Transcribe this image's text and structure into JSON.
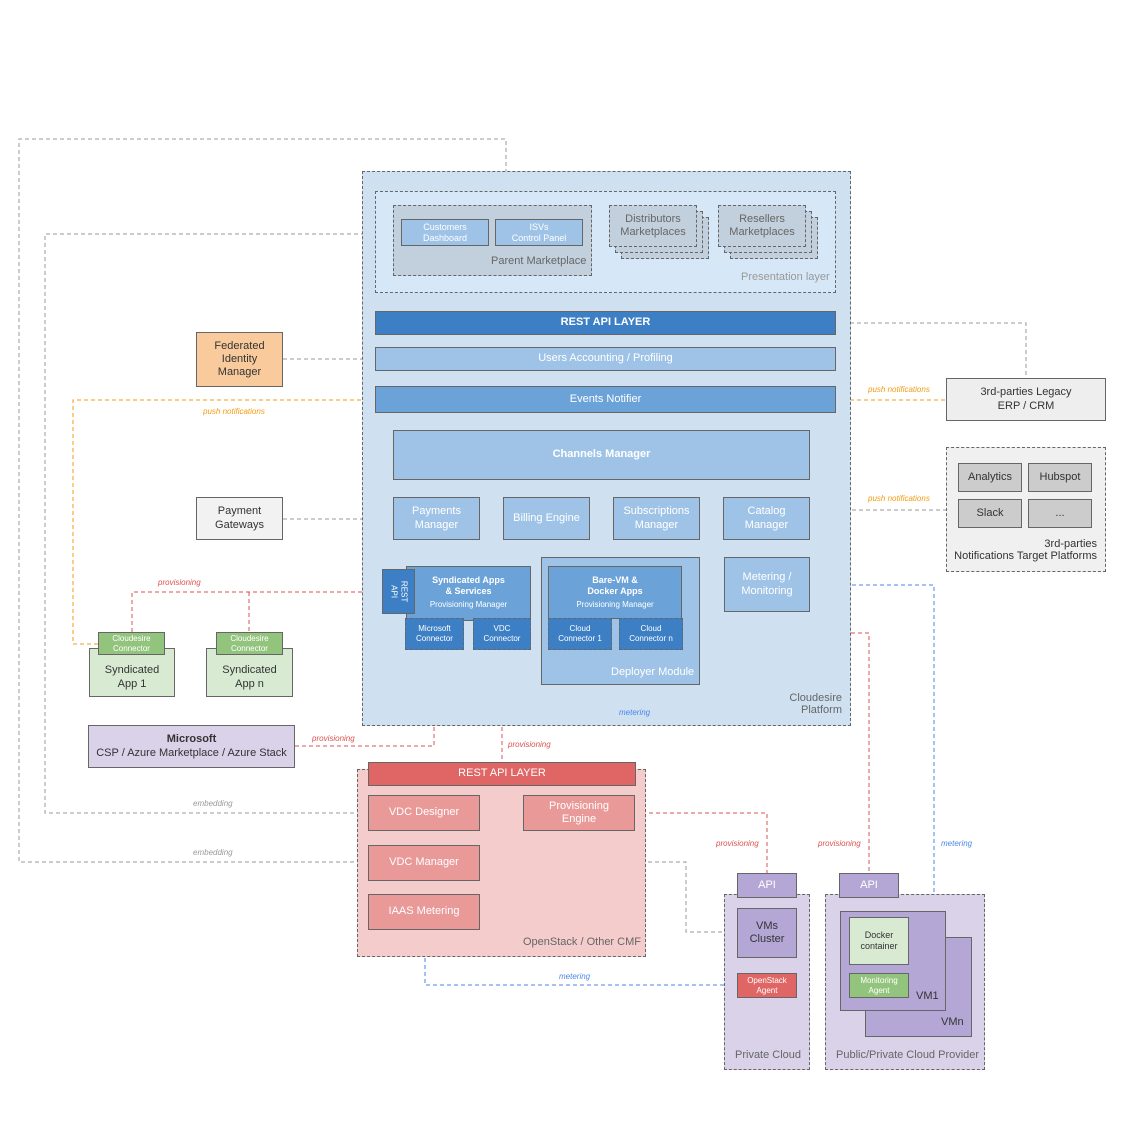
{
  "colors": {
    "platform": "#cfe0f1",
    "rest": "#3d7fc4",
    "light_blue": "#9fc3e7",
    "mid_blue": "#6ba3d9",
    "orange": "#f39c12",
    "red": "#d9534f",
    "blue_line": "#4a86e8",
    "gray_line": "#999999",
    "openstack": "#f4cccc",
    "purple": "#d9d2e9",
    "green": "#93c47d"
  },
  "platform": {
    "label": "Cloudesire\nPlatform",
    "presentation_label": "Presentation layer",
    "parent_marketplace": "Parent Marketplace",
    "customers_dashboard": "Customers\nDashboard",
    "isvs_panel": "ISVs\nControl Panel",
    "distributors": "Distributors\nMarketplaces",
    "resellers": "Resellers\nMarketplaces",
    "rest_api": "REST API LAYER",
    "users_accounting": "Users Accounting / Profiling",
    "events_notifier": "Events Notifier",
    "channels_manager": "Channels Manager",
    "payments_manager": "Payments\nManager",
    "billing_engine": "Billing Engine",
    "subscriptions_manager": "Subscriptions\nManager",
    "catalog_manager": "Catalog\nManager",
    "syndicated_title": "Syndicated Apps\n& Services",
    "syndicated_sub": "Provisioning Manager",
    "rest_api_small": "REST\nAPI",
    "microsoft_connector": "Microsoft\nConnector",
    "vdc_connector": "VDC\nConnector",
    "deployer_module": "Deployer Module",
    "baremetal_title": "Bare-VM &\nDocker Apps",
    "baremetal_sub": "Provisioning Manager",
    "cloud_connector_1": "Cloud\nConnector 1",
    "cloud_connector_n": "Cloud\nConnector n",
    "metering": "Metering /\nMonitoring"
  },
  "external": {
    "federated_identity": "Federated\nIdentity\nManager",
    "payment_gateways": "Payment\nGateways",
    "legacy_erp": "3rd-parties Legacy\nERP / CRM",
    "notifications_label": "3rd-parties\nNotifications Target Platforms",
    "analytics": "Analytics",
    "hubspot": "Hubspot",
    "slack": "Slack",
    "more": "...",
    "cloudesire_connector": "Cloudesire\nConnector",
    "syndicated_app_1": "Syndicated\nApp 1",
    "syndicated_app_n": "Syndicated\nApp n",
    "microsoft_title": "Microsoft",
    "microsoft_sub": "CSP / Azure Marketplace / Azure Stack"
  },
  "openstack": {
    "rest_api": "REST API LAYER",
    "vdc_designer": "VDC Designer",
    "provisioning_engine": "Provisioning\nEngine",
    "vdc_manager": "VDC Manager",
    "iaas_metering": "IAAS Metering",
    "label": "OpenStack / Other CMF"
  },
  "private_cloud": {
    "api": "API",
    "vms_cluster": "VMs\nCluster",
    "openstack_agent": "OpenStack\nAgent",
    "label": "Private Cloud"
  },
  "public_cloud": {
    "api": "API",
    "docker": "Docker\ncontainer",
    "monitoring_agent": "Monitoring\nAgent",
    "vm1": "VM1",
    "vmn": "VMn",
    "label": "Public/Private Cloud Provider"
  },
  "edge_labels": {
    "push_notifications": "push notifications",
    "provisioning": "provisioning",
    "metering": "metering",
    "embedding": "embedding"
  }
}
